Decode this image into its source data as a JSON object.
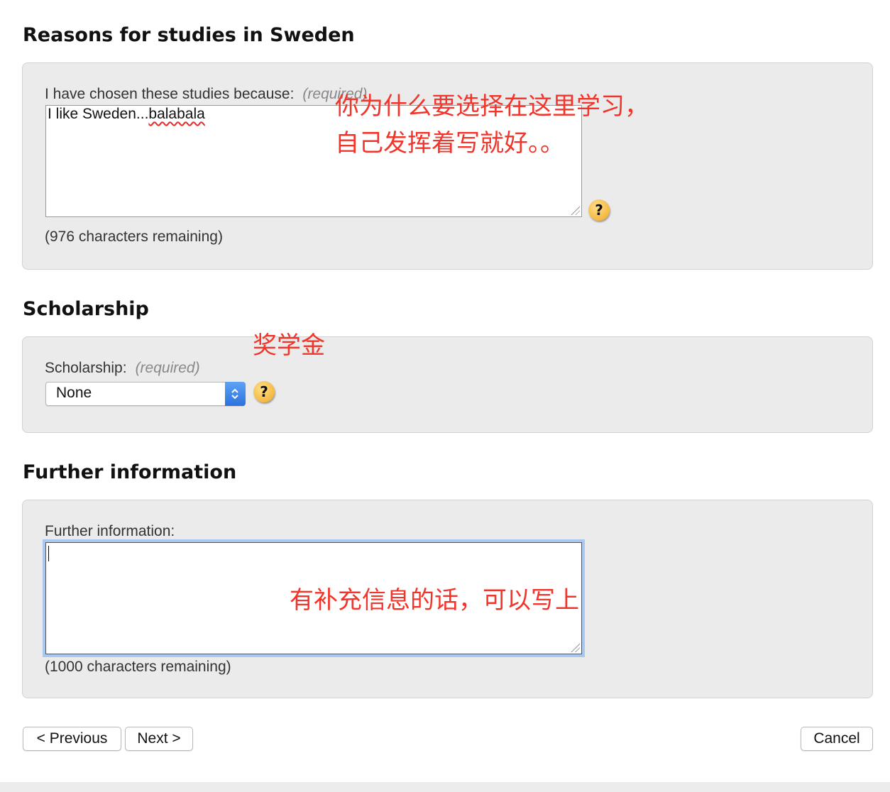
{
  "sections": {
    "reasons": {
      "title": "Reasons for studies in Sweden",
      "label": "I have chosen these studies because:",
      "required": "(required)",
      "text_plain": "I like Sweden...",
      "text_misspelled": "balabala",
      "remaining": "(976 characters remaining)"
    },
    "scholarship": {
      "title": "Scholarship",
      "label": "Scholarship:",
      "required": "(required)",
      "selected": "None"
    },
    "further": {
      "title": "Further information",
      "label": "Further information:",
      "text": "",
      "remaining": "(1000 characters remaining)"
    }
  },
  "help_icon_glyph": "?",
  "annotations": {
    "reasons_line1": "你为什么要选择在这里学习，",
    "reasons_line2": "自己发挥着写就好。。",
    "scholarship": "奖学金",
    "further": "有补充信息的话，可以写上"
  },
  "buttons": {
    "previous": "< Previous",
    "next": "Next >",
    "cancel": "Cancel"
  },
  "colors": {
    "annotation": "#f2342a",
    "panel_bg": "#ebebeb",
    "focus_ring": "#a9c8ef",
    "select_arrow": "#2a72de"
  }
}
